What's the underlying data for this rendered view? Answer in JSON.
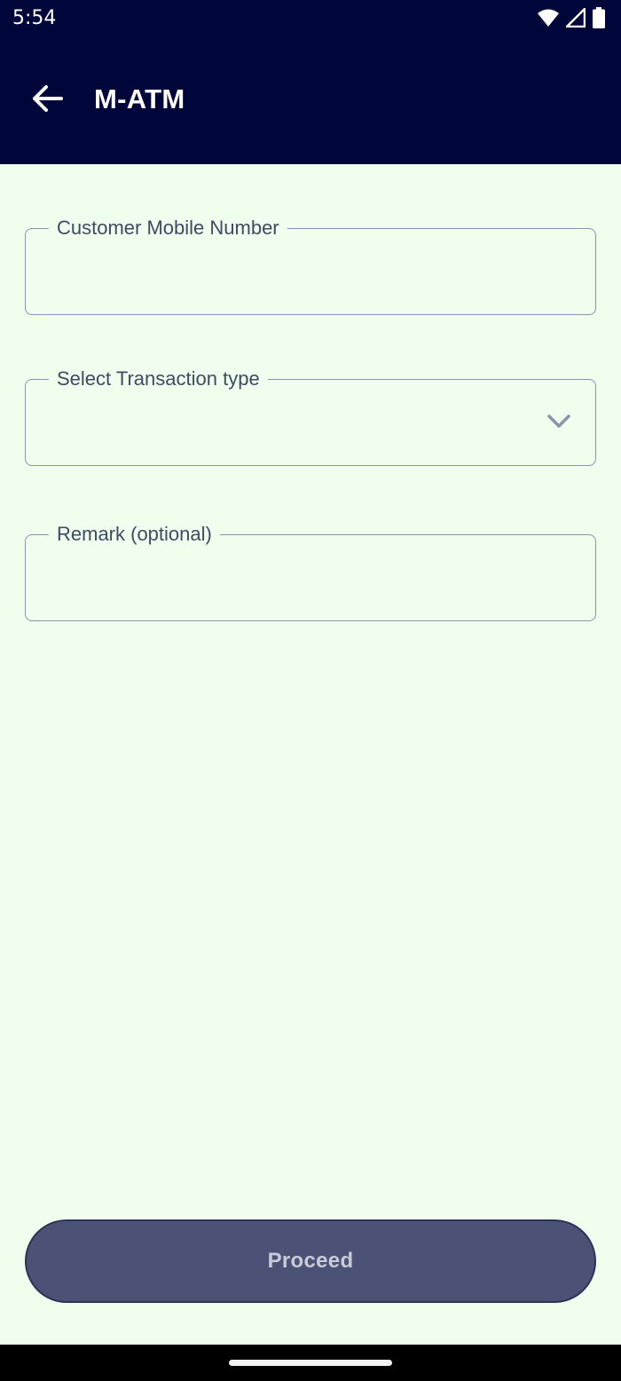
{
  "status_bar": {
    "time": "5:54",
    "icons": [
      "wifi-icon",
      "cell-signal-icon",
      "battery-icon"
    ]
  },
  "app_bar": {
    "title": "M-ATM",
    "back_icon": "arrow-left-icon"
  },
  "form": {
    "mobile_number": {
      "label": "Customer Mobile Number",
      "value": ""
    },
    "transaction_type": {
      "label": "Select Transaction type",
      "value": "",
      "icon": "chevron-down-icon"
    },
    "remark": {
      "label": "Remark (optional)",
      "value": ""
    }
  },
  "actions": {
    "proceed_label": "Proceed"
  },
  "colors": {
    "header_bg": "#00053a",
    "page_bg": "#f0feee",
    "field_border": "#8a92ac",
    "label_text": "#3f4a63",
    "button_bg": "#4b5275",
    "button_text": "#c8cbd8"
  }
}
